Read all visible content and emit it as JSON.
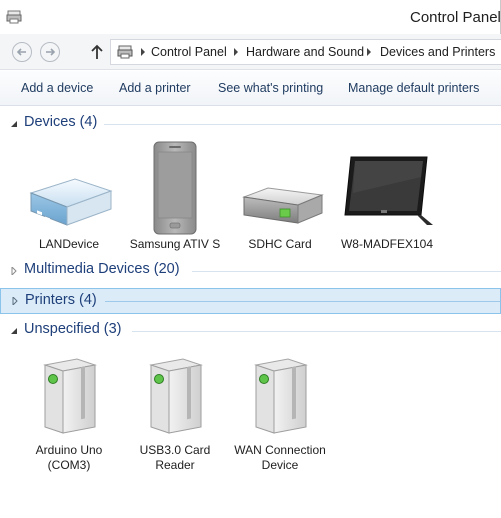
{
  "window": {
    "title": "Control Panel\\"
  },
  "address": {
    "crumbs": [
      "Control Panel",
      "Hardware and Sound",
      "Devices and Printers"
    ]
  },
  "toolbar": {
    "items": [
      "Add a device",
      "Add a printer",
      "See what's printing",
      "Manage default printers"
    ]
  },
  "groups": {
    "devices": {
      "label": "Devices (4)",
      "items": [
        {
          "name": "LANDevice",
          "icon": "router-icon"
        },
        {
          "name": "Samsung ATIV S",
          "icon": "phone-icon"
        },
        {
          "name": "SDHC Card",
          "icon": "drive-icon"
        },
        {
          "name": "W8-MADFEX104",
          "icon": "tablet-icon"
        }
      ]
    },
    "multimedia": {
      "label": "Multimedia Devices (20)"
    },
    "printers": {
      "label": "Printers (4)"
    },
    "unspecified": {
      "label": "Unspecified (3)",
      "items": [
        {
          "name": "Arduino Uno (COM3)",
          "icon": "generic-device-icon"
        },
        {
          "name": "USB3.0 Card Reader",
          "icon": "generic-device-icon"
        },
        {
          "name": "WAN Connection Device",
          "icon": "generic-device-icon"
        }
      ]
    }
  },
  "colors": {
    "group_label": "#1e3f7a",
    "selection_bg": "#dbecf8",
    "selection_border": "#8cc3ea",
    "toolbar_text": "#1e3a5f"
  }
}
